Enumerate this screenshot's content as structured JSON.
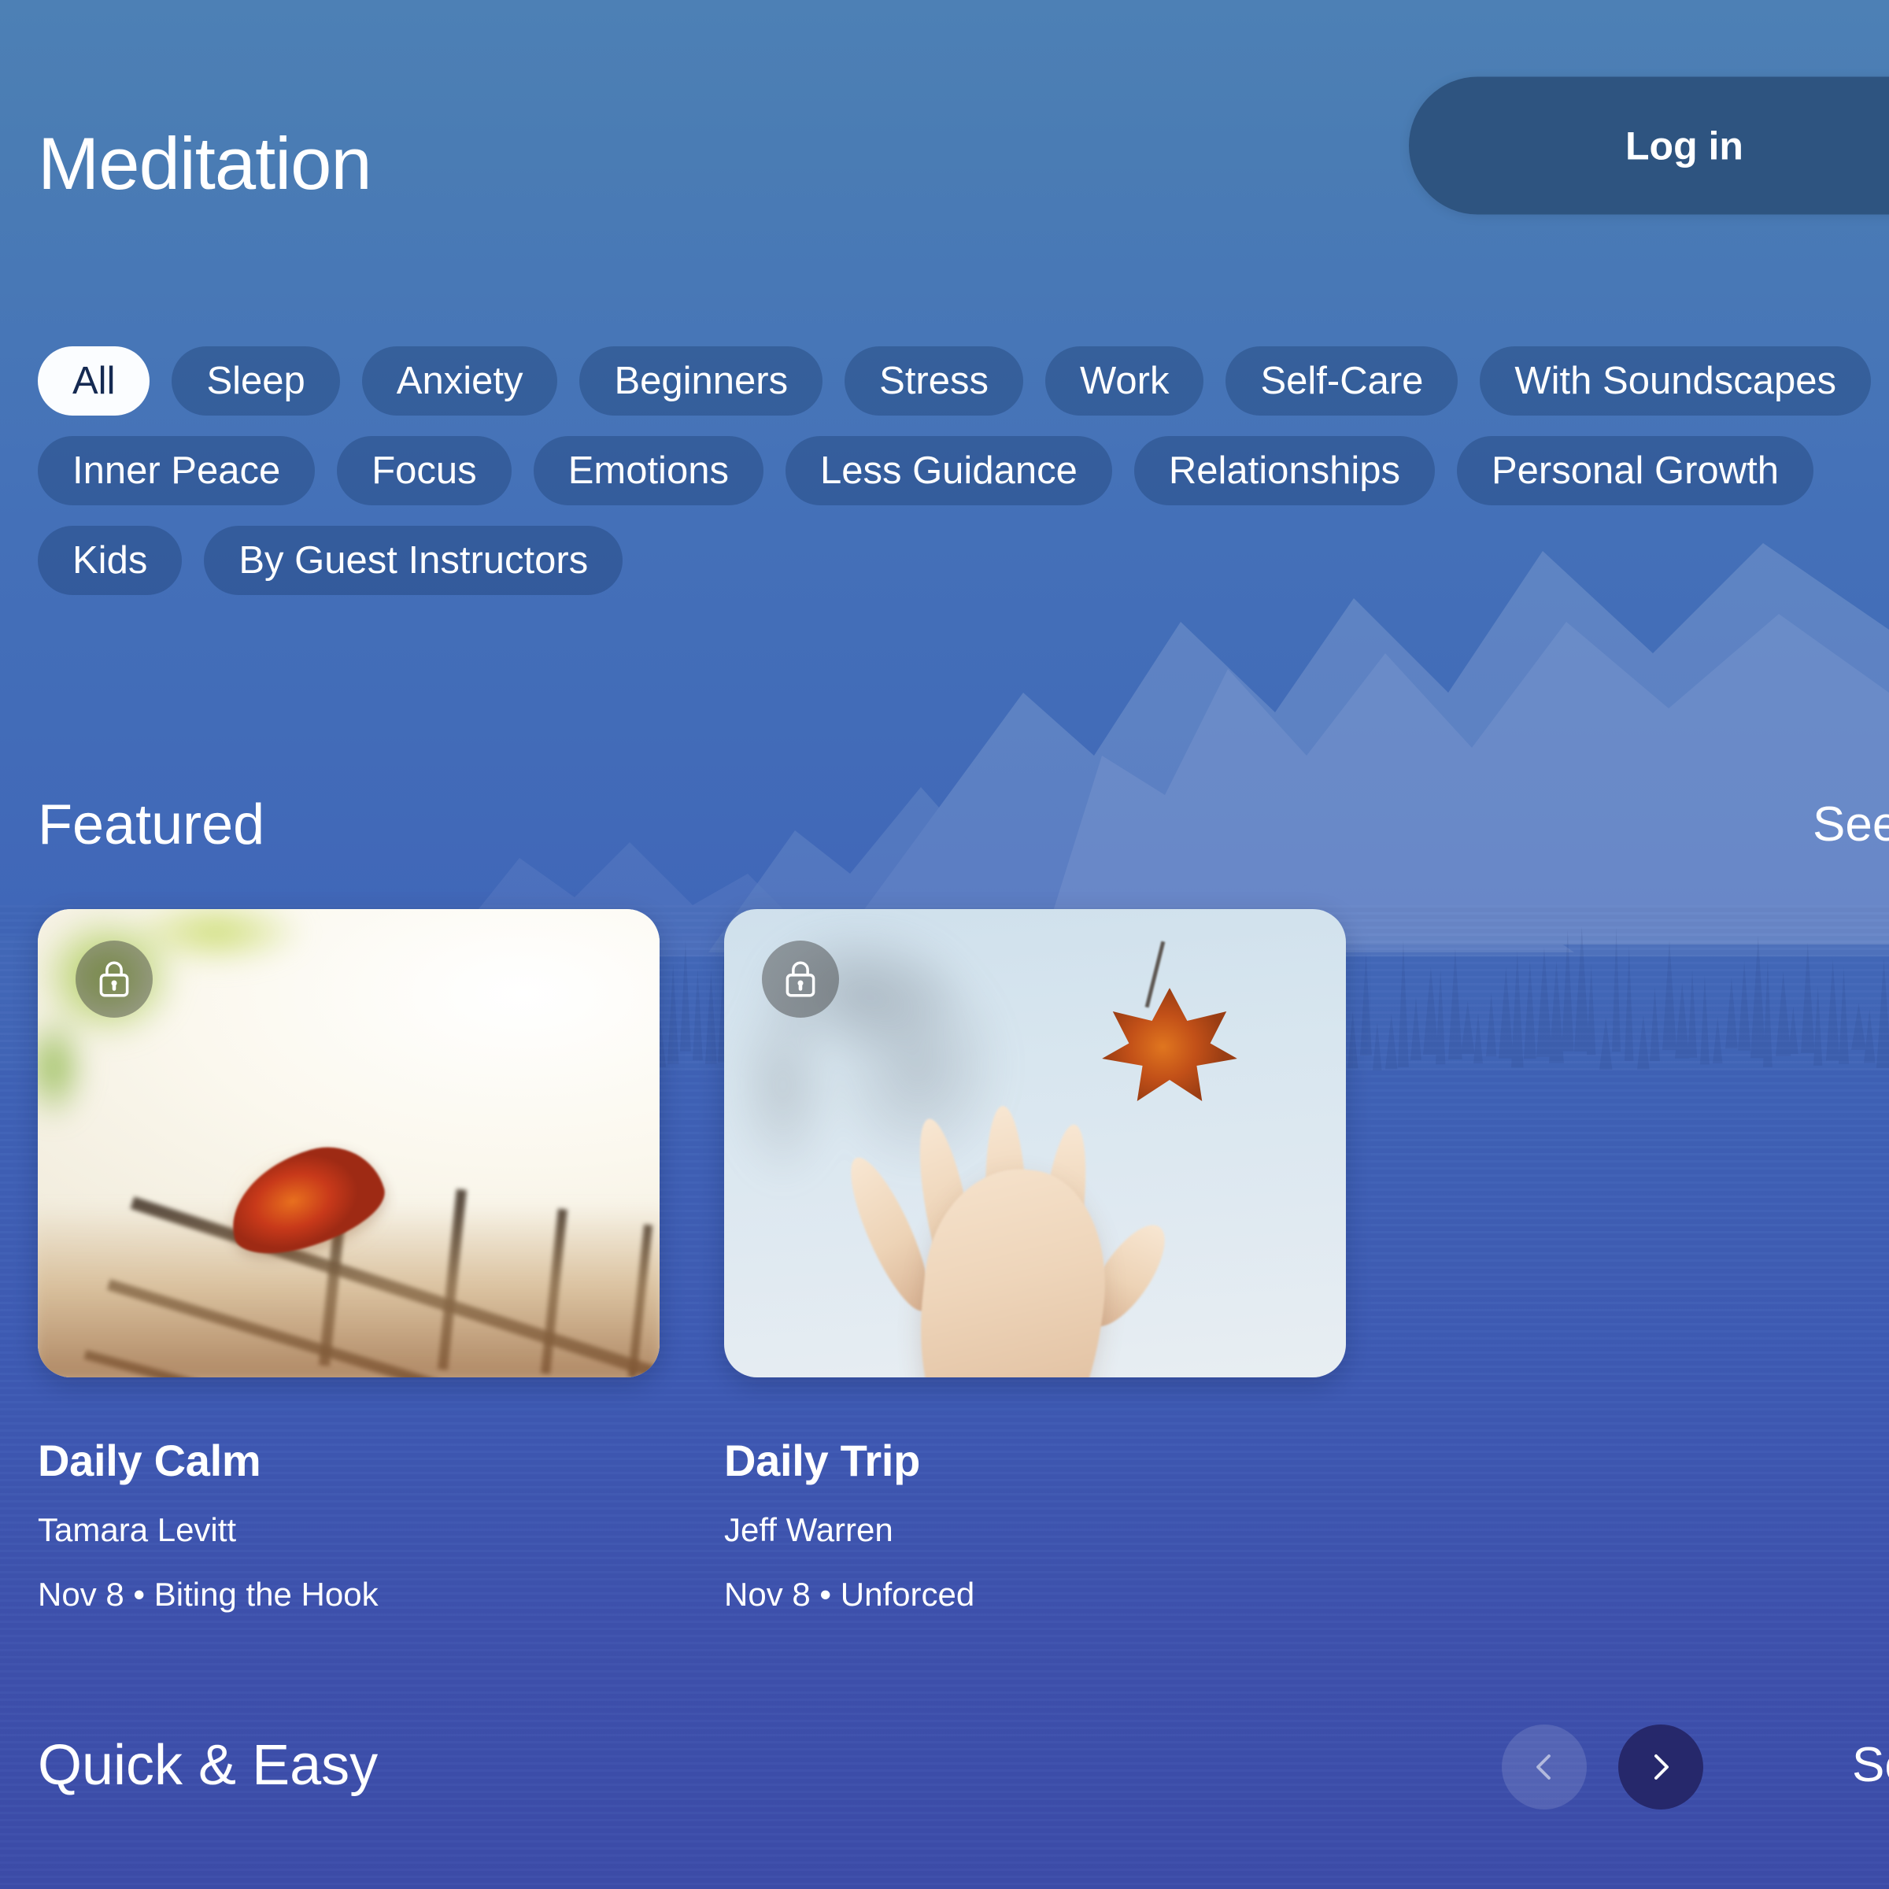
{
  "header": {
    "title": "Meditation",
    "login_label": "Log in"
  },
  "filters": {
    "chips": [
      {
        "label": "All",
        "selected": true
      },
      {
        "label": "Sleep",
        "selected": false
      },
      {
        "label": "Anxiety",
        "selected": false
      },
      {
        "label": "Beginners",
        "selected": false
      },
      {
        "label": "Stress",
        "selected": false
      },
      {
        "label": "Work",
        "selected": false
      },
      {
        "label": "Self-Care",
        "selected": false
      },
      {
        "label": "With Soundscapes",
        "selected": false
      },
      {
        "label": "Inner Peace",
        "selected": false
      },
      {
        "label": "Focus",
        "selected": false
      },
      {
        "label": "Emotions",
        "selected": false
      },
      {
        "label": "Less Guidance",
        "selected": false
      },
      {
        "label": "Relationships",
        "selected": false
      },
      {
        "label": "Personal Growth",
        "selected": false
      },
      {
        "label": "Kids",
        "selected": false
      },
      {
        "label": "By Guest Instructors",
        "selected": false
      }
    ]
  },
  "sections": {
    "featured": {
      "title": "Featured",
      "see_all_label": "See",
      "cards": [
        {
          "title": "Daily Calm",
          "author": "Tamara Levitt",
          "meta": "Nov 8 • Biting the Hook",
          "locked": true,
          "lock_icon": "lock-icon"
        },
        {
          "title": "Daily Trip",
          "author": "Jeff Warren",
          "meta": "Nov 8 • Unforced",
          "locked": true,
          "lock_icon": "lock-icon"
        }
      ]
    },
    "quick_easy": {
      "title": "Quick & Easy",
      "see_all_label": "See",
      "prev_icon": "chevron-left-icon",
      "next_icon": "chevron-right-icon"
    }
  },
  "colors": {
    "bg_top": "#4d80b5",
    "bg_bottom": "#3d4daa",
    "login_bg": "#2e5480",
    "chip_bg": "rgba(18,48,92,0.30)",
    "chip_selected_bg": "#fbfdff",
    "chip_selected_text": "#152a52",
    "next_btn_bg": "#26286b",
    "text": "#ffffff"
  }
}
